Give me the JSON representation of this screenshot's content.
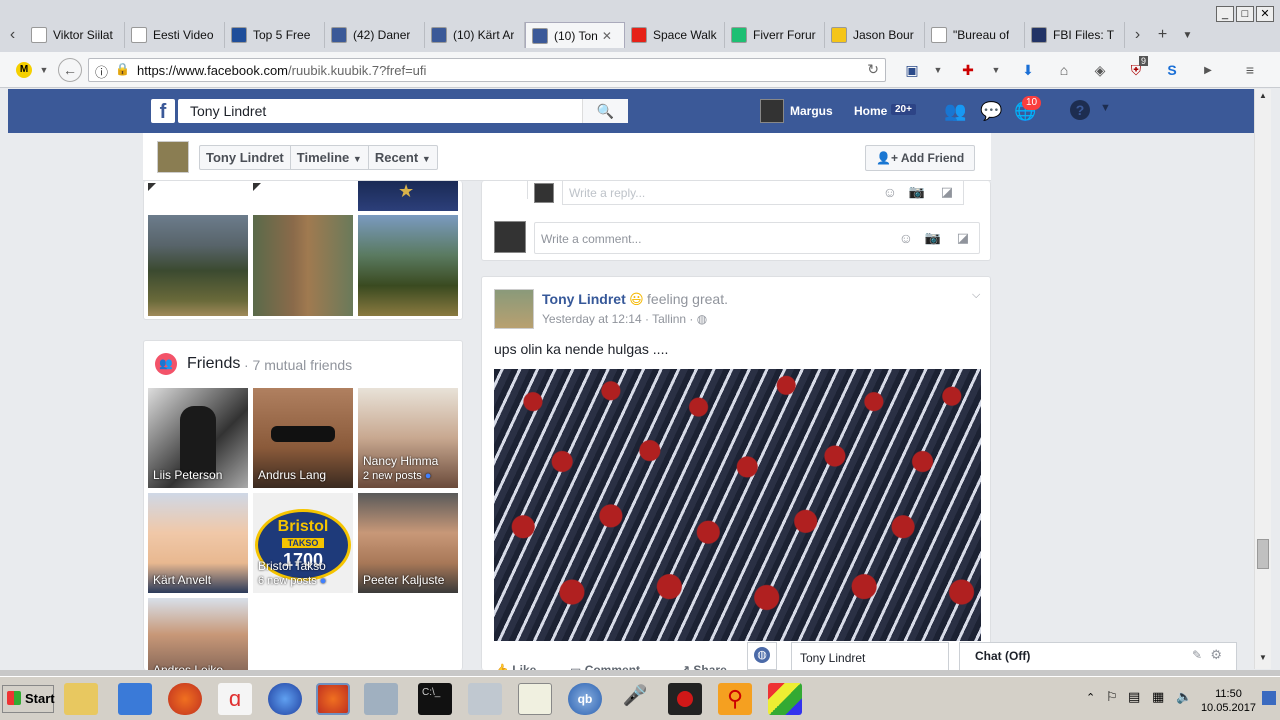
{
  "browser": {
    "tabs": [
      {
        "label": "Viktor Siilat",
        "icon": "document-icon",
        "color": "#ffffff"
      },
      {
        "label": "Eesti Video",
        "icon": "wikipedia-icon",
        "color": "#ffffff"
      },
      {
        "label": "Top 5 Free",
        "icon": "h-icon",
        "color": "#1f4e9a"
      },
      {
        "label": "(42) Daner",
        "icon": "facebook-icon",
        "color": "#3b5998"
      },
      {
        "label": "(10) Kärt Ar",
        "icon": "facebook-icon",
        "color": "#3b5998"
      },
      {
        "label": "(10) Ton",
        "icon": "facebook-icon",
        "color": "#3b5998",
        "active": true
      },
      {
        "label": "Space Walk",
        "icon": "youtube-icon",
        "color": "#e62117"
      },
      {
        "label": "Fiverr Forur",
        "icon": "fiverr-icon",
        "color": "#1dbf73"
      },
      {
        "label": "Jason Bour",
        "icon": "imdb-icon",
        "color": "#f5c518"
      },
      {
        "label": "\"Bureau of",
        "icon": "google-icon",
        "color": "#ffffff"
      },
      {
        "label": "FBI Files: T",
        "icon": "fbi-icon",
        "color": "#223366"
      }
    ],
    "url_host": "https://www.facebook.com",
    "url_path": "/ruubik.kuubik.7?fref=ufi",
    "addon_badge": "9"
  },
  "fb": {
    "search_value": "Tony Lindret",
    "user_name": "Margus",
    "home_label": "Home",
    "home_count": "20+",
    "notif_count": "10"
  },
  "profile": {
    "name_button": "Tony Lindret",
    "timeline_button": "Timeline",
    "recent_button": "Recent",
    "add_friend": "Add Friend"
  },
  "friends": {
    "title": "Friends",
    "mutual": "· 7 mutual friends",
    "items": [
      {
        "name": "Liis Peterson",
        "sub": ""
      },
      {
        "name": "Andrus Lang",
        "sub": ""
      },
      {
        "name": "Nancy Himma",
        "sub": "2 new posts"
      },
      {
        "name": "Kärt Anvelt",
        "sub": ""
      },
      {
        "name": "Bristol Takso",
        "sub": "6 new posts"
      },
      {
        "name": "Peeter Kaljuste",
        "sub": ""
      },
      {
        "name": "Andres Leiko",
        "sub": ""
      }
    ],
    "bristol_logo": "Bristol",
    "bristol_logo2": "TAKSO",
    "bristol_logo3": "1700"
  },
  "comments": {
    "reply_placeholder": "Write a reply...",
    "comment_placeholder": "Write a comment..."
  },
  "post": {
    "author": "Tony Lindret",
    "feeling": "feeling great.",
    "time": "Yesterday at 12:14 · Tallinn ·",
    "text": "ups olin ka nende hulgas ....",
    "like": "Like",
    "comment": "Comment",
    "share": "Share"
  },
  "chat": {
    "tab_name": "Tony Lindret",
    "status": "Chat (Off)"
  },
  "taskbar": {
    "start": "Start",
    "time": "11:50",
    "date": "10.05.2017"
  }
}
